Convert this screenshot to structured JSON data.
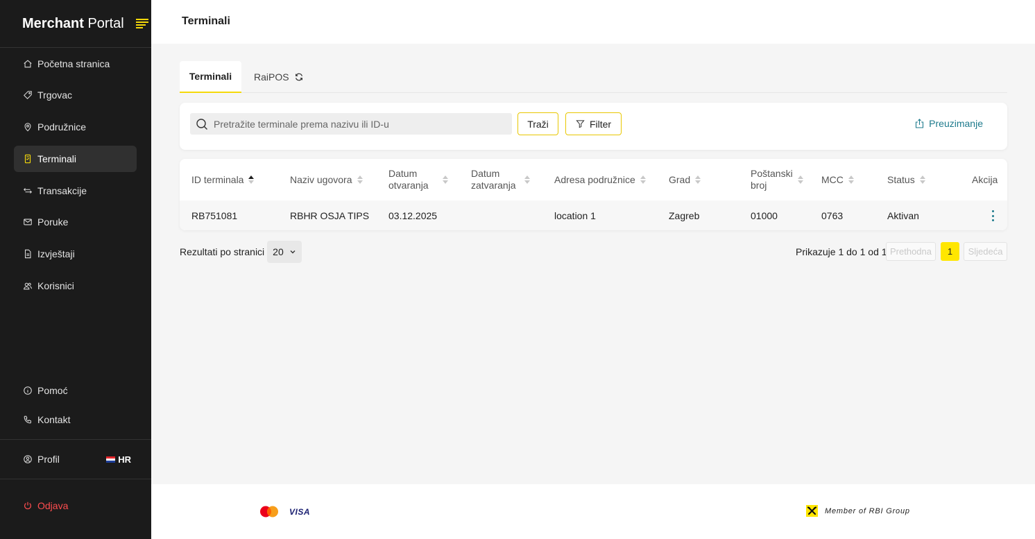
{
  "sidebar": {
    "brand_bold": "Merchant",
    "brand_light": "Portal",
    "items": [
      {
        "label": "Početna stranica",
        "icon": "home-icon"
      },
      {
        "label": "Trgovac",
        "icon": "tag-icon"
      },
      {
        "label": "Podružnice",
        "icon": "location-pin-icon"
      },
      {
        "label": "Terminali",
        "icon": "terminal-icon",
        "active": true
      },
      {
        "label": "Transakcije",
        "icon": "transfer-arrows-icon"
      },
      {
        "label": "Poruke",
        "icon": "mail-icon"
      },
      {
        "label": "Izvještaji",
        "icon": "document-icon"
      },
      {
        "label": "Korisnici",
        "icon": "users-icon"
      }
    ],
    "help": "Pomoć",
    "contact": "Kontakt",
    "profile": "Profil",
    "language": "HR",
    "logout": "Odjava"
  },
  "header": {
    "title": "Terminali"
  },
  "tabs": [
    {
      "label": "Terminali",
      "active": true
    },
    {
      "label": "RaiPOS",
      "icon": "refresh-icon"
    }
  ],
  "search": {
    "placeholder": "Pretražite terminale prema nazivu ili ID-u",
    "value": "",
    "search_label": "Traži",
    "filter_label": "Filter",
    "download_label": "Preuzimanje"
  },
  "table": {
    "columns": [
      {
        "line1": "ID terminala",
        "line2": "",
        "sort": "asc"
      },
      {
        "line1": "Naziv ugovora",
        "line2": "",
        "sort": "none"
      },
      {
        "line1": "Datum",
        "line2": "otvaranja",
        "sort": "none"
      },
      {
        "line1": "Datum",
        "line2": "zatvaranja",
        "sort": "none"
      },
      {
        "line1": "Adresa podružnice",
        "line2": "",
        "sort": "none"
      },
      {
        "line1": "Grad",
        "line2": "",
        "sort": "none"
      },
      {
        "line1": "Poštanski",
        "line2": "broj",
        "sort": "none"
      },
      {
        "line1": "MCC",
        "line2": "",
        "sort": "none"
      },
      {
        "line1": "Status",
        "line2": "",
        "sort": "none"
      },
      {
        "line1": "Akcija",
        "line2": "",
        "sort": "off"
      }
    ],
    "rows": [
      [
        "RB751081",
        "RBHR OSJA TIPS",
        "03.12.2025",
        "",
        "location 1",
        "Zagreb",
        "01000",
        "0763",
        "Aktivan"
      ]
    ]
  },
  "pagination": {
    "rows_per_page_label": "Rezultati po stranici",
    "rows_per_page": "20",
    "info": "Prikazuje 1 do 1 od 1",
    "prev": "Prethodna",
    "current_page": "1",
    "next": "Sljedeća"
  },
  "footer": {
    "visa": "VISA",
    "rbi": "Member of RBI Group"
  },
  "colors": {
    "accent": "#f5d90a",
    "sidebar_bg": "#1b1b1b",
    "link": "#1d7a8c",
    "logout": "#ff4d4f"
  }
}
